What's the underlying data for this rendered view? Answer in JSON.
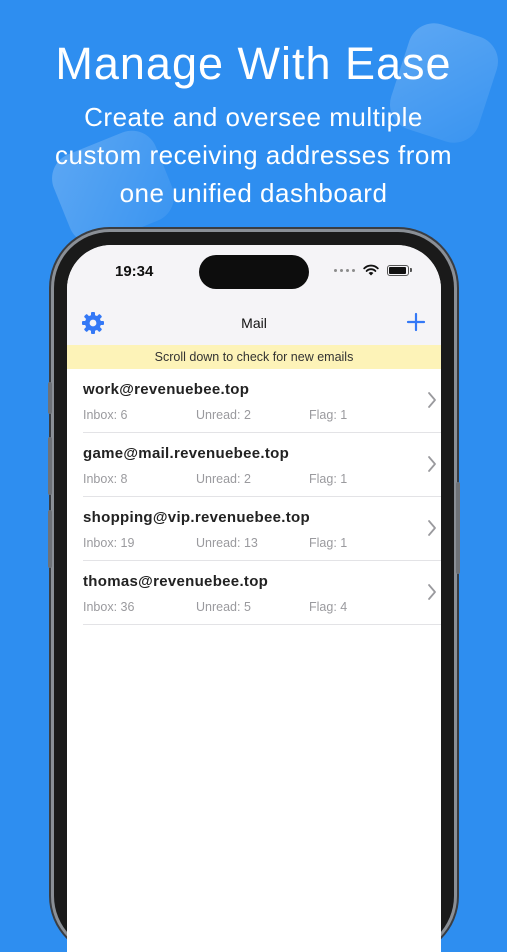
{
  "promo": {
    "headline": "Manage With Ease",
    "subline_1": "Create and oversee multiple",
    "subline_2": "custom receiving addresses from",
    "subline_3": "one unified dashboard"
  },
  "status_bar": {
    "time": "19:34"
  },
  "nav": {
    "title": "Mail",
    "settings_icon": "gear-icon",
    "add_icon": "plus-icon"
  },
  "banner": {
    "text": "Scroll down to check for new emails"
  },
  "accounts": [
    {
      "address": "work@revenuebee.top",
      "inbox": "Inbox: 6",
      "unread": "Unread: 2",
      "flag": "Flag: 1"
    },
    {
      "address": "game@mail.revenuebee.top",
      "inbox": "Inbox: 8",
      "unread": "Unread: 2",
      "flag": "Flag: 1"
    },
    {
      "address": "shopping@vip.revenuebee.top",
      "inbox": "Inbox: 19",
      "unread": "Unread: 13",
      "flag": "Flag: 1"
    },
    {
      "address": "thomas@revenuebee.top",
      "inbox": "Inbox: 36",
      "unread": "Unread: 5",
      "flag": "Flag: 4"
    }
  ],
  "colors": {
    "background": "#2e8ef0",
    "accent": "#3478f6",
    "banner": "#fdf3b8"
  }
}
